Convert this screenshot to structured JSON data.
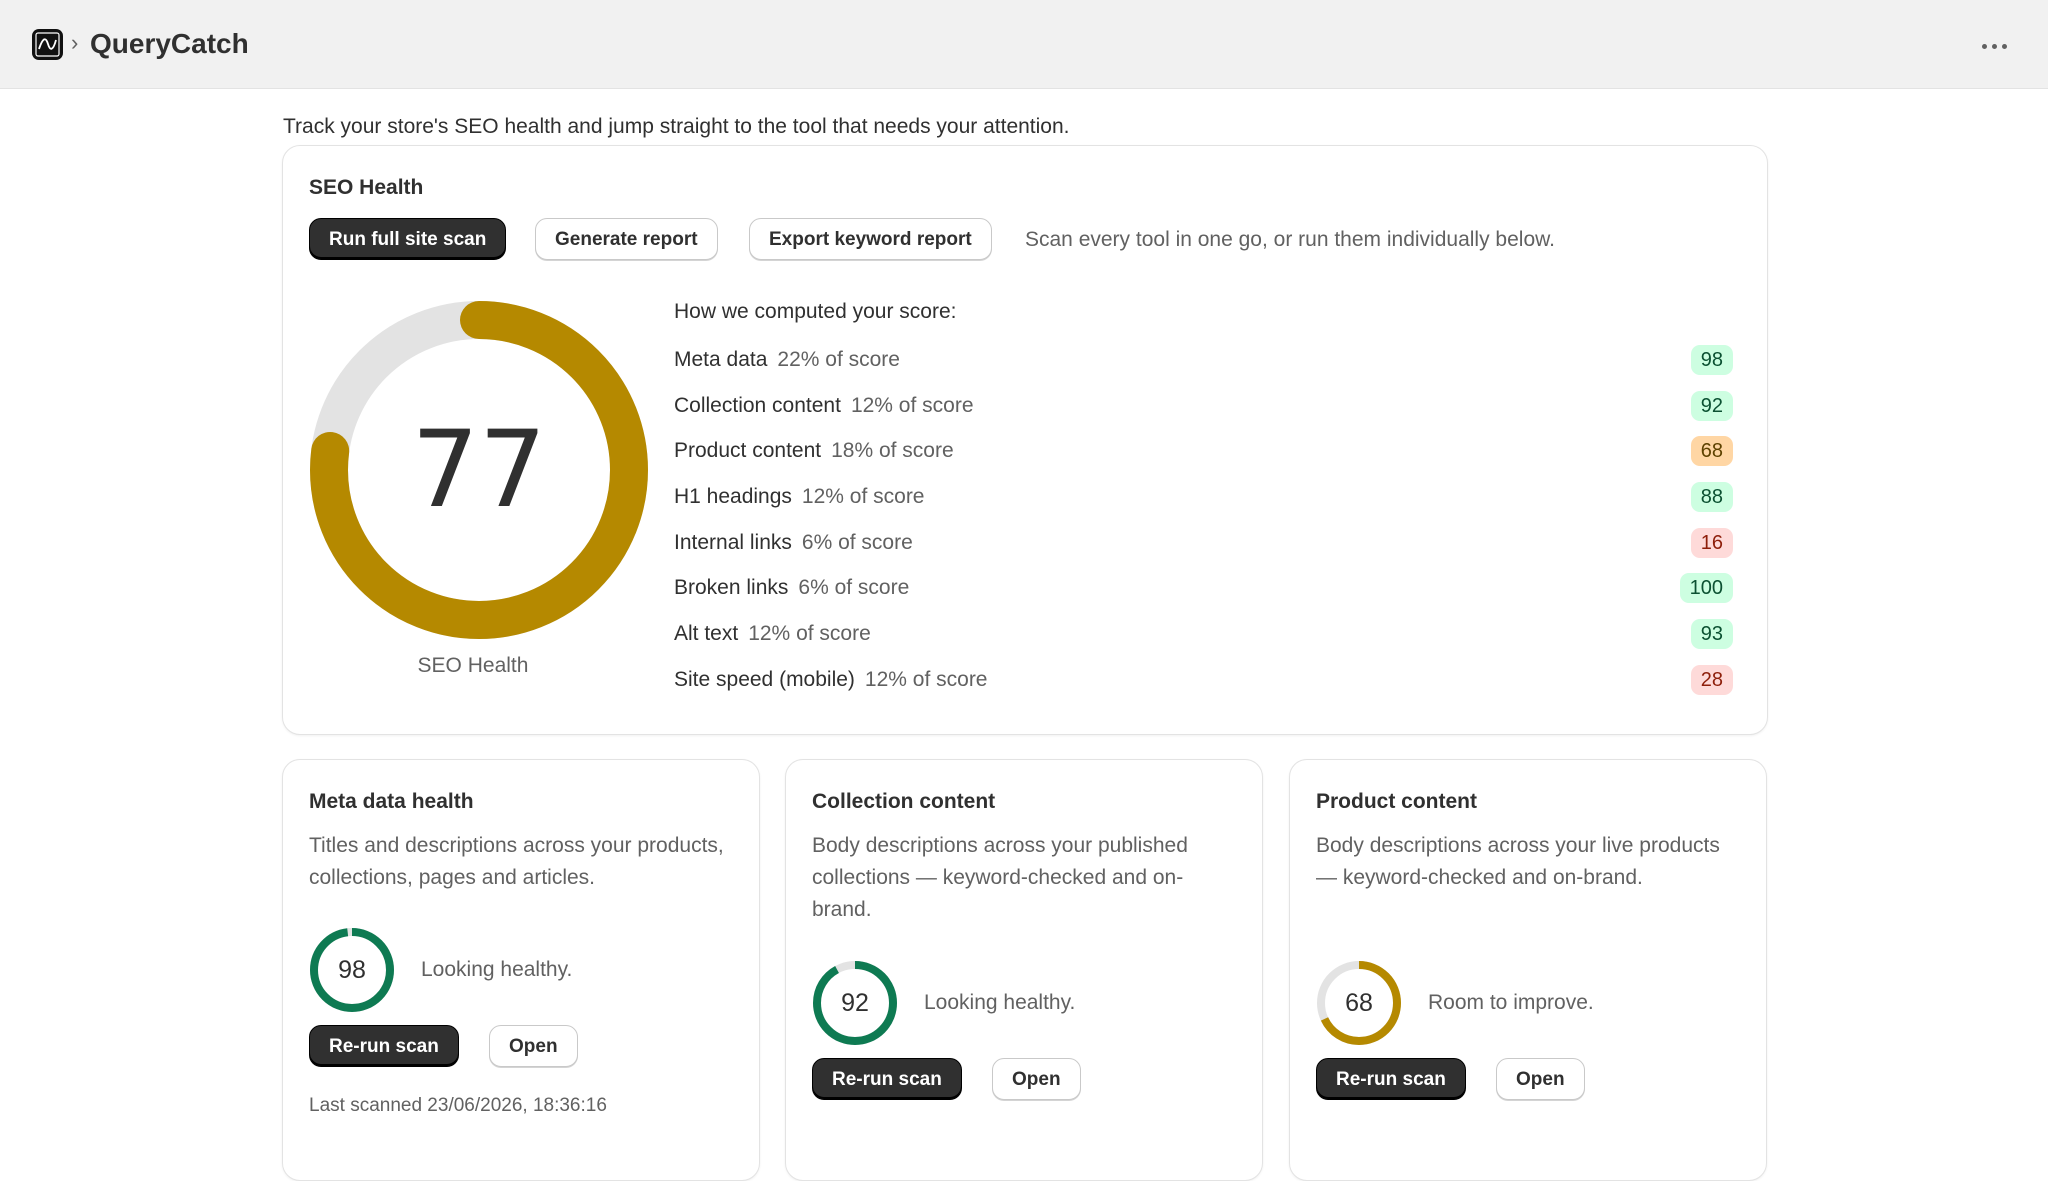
{
  "app": {
    "title": "QueryCatch"
  },
  "intro": "Track your store's SEO health and jump straight to the tool that needs your attention.",
  "seo_health": {
    "title": "SEO Health",
    "buttons": {
      "run_scan": "Run full site scan",
      "generate_report": "Generate report",
      "export_keywords": "Export keyword report"
    },
    "hint": "Scan every tool in one go, or run them individually below.",
    "score": 77,
    "score_max": 100,
    "score_label": "SEO Health",
    "breakdown_title": "How we computed your score:",
    "breakdown": [
      {
        "label": "Meta data",
        "weight": "22% of score",
        "score": "98",
        "status": "green"
      },
      {
        "label": "Collection content",
        "weight": "12% of score",
        "score": "92",
        "status": "green"
      },
      {
        "label": "Product content",
        "weight": "18% of score",
        "score": "68",
        "status": "orange"
      },
      {
        "label": "H1 headings",
        "weight": "12% of score",
        "score": "88",
        "status": "green"
      },
      {
        "label": "Internal links",
        "weight": "6% of score",
        "score": "16",
        "status": "red"
      },
      {
        "label": "Broken links",
        "weight": "6% of score",
        "score": "100",
        "status": "green"
      },
      {
        "label": "Alt text",
        "weight": "12% of score",
        "score": "93",
        "status": "green"
      },
      {
        "label": "Site speed (mobile)",
        "weight": "12% of score",
        "score": "28",
        "status": "red"
      }
    ]
  },
  "tools": [
    {
      "title": "Meta data health",
      "description": "Titles and descriptions across your products, collections, pages and articles.",
      "score": 98,
      "status": "Looking healthy.",
      "rerun": "Re-run scan",
      "open": "Open",
      "last_scanned": "Last scanned 23/06/2026, 18:36:16"
    },
    {
      "title": "Collection content",
      "description": "Body descriptions across your published collections — keyword-checked and on-brand.",
      "score": 92,
      "status": "Looking healthy.",
      "rerun": "Re-run scan",
      "open": "Open"
    },
    {
      "title": "Product content",
      "description": "Body descriptions across your live products — keyword-checked and on-brand.",
      "score": 68,
      "status": "Room to improve.",
      "rerun": "Re-run scan",
      "open": "Open"
    }
  ],
  "colors": {
    "gauge_fill": "#b58900",
    "gauge_track": "#e3e3e3",
    "healthy": "#0e7a52",
    "improve": "#b58900",
    "primary_button": "#303030"
  },
  "icons": {
    "app_logo": "querycatch-logo-icon",
    "breadcrumb": "chevron-right-icon",
    "menu": "more-horizontal-icon"
  }
}
